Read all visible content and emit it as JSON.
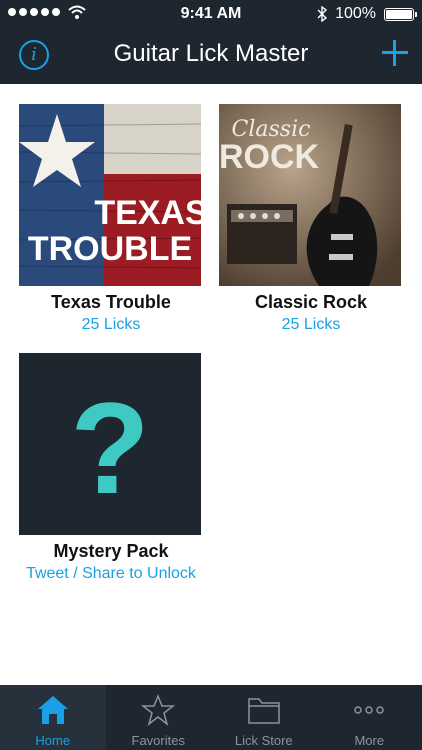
{
  "status_bar": {
    "time": "9:41 AM",
    "battery": "100%",
    "signal_icon": "signal-dots-icon",
    "wifi_icon": "wifi-icon",
    "bluetooth_icon": "bluetooth-icon",
    "battery_icon": "battery-icon"
  },
  "nav": {
    "title": "Guitar Lick Master",
    "info_icon": "info-icon",
    "info_glyph": "i",
    "add_icon": "plus-icon"
  },
  "packs": [
    {
      "title": "Texas Trouble",
      "subtitle": "25 Licks",
      "cover_text_line1": "TEXAS",
      "cover_text_line2": "TROUBLE"
    },
    {
      "title": "Classic Rock",
      "subtitle": "25 Licks",
      "cover_text_line1": "Classic",
      "cover_text_line2": "ROCK"
    },
    {
      "title": "Mystery Pack",
      "subtitle": "Tweet / Share to Unlock",
      "cover_text_line1": "?"
    }
  ],
  "tabs": [
    {
      "label": "Home",
      "icon": "home-icon",
      "active": true
    },
    {
      "label": "Favorites",
      "icon": "star-icon",
      "active": false
    },
    {
      "label": "Lick Store",
      "icon": "folder-icon",
      "active": false
    },
    {
      "label": "More",
      "icon": "more-dots-icon",
      "active": false
    }
  ],
  "colors": {
    "nav_background": "#1e2730",
    "accent": "#1aa0e6",
    "mystery_question": "#3ec9c3",
    "tab_inactive": "#8a949c"
  }
}
